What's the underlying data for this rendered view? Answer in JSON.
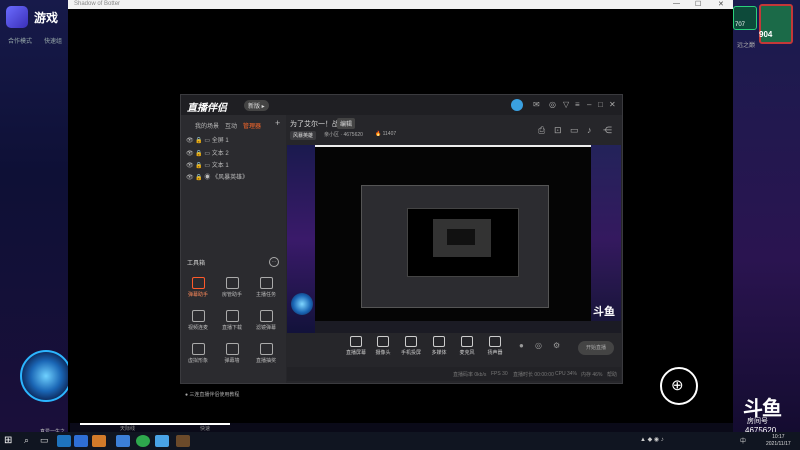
{
  "window": {
    "title": "Shadow of Botter",
    "controls": [
      "—",
      "☐",
      "✕"
    ]
  },
  "game": {
    "title": "游戏",
    "sub_labels": [
      "合作模式",
      "快速组"
    ],
    "hero_caption": "真爱一生之",
    "score": "904",
    "right_label": "远之巅",
    "right_badge": "707"
  },
  "douyu": {
    "brand": "斗鱼",
    "room_label": "房间号",
    "room_number": "4675620"
  },
  "app": {
    "brand": "直播伴侣",
    "version": "新版 ▸",
    "tabs": [
      "我的场景",
      "互动",
      "管理器"
    ],
    "add": "+",
    "sources": [
      "全屏 1",
      "文本 2",
      "文本 1",
      "《风暴英雄》"
    ],
    "toolbox_title": "工具箱",
    "more": "···",
    "tools": [
      {
        "label": "弹幕助手",
        "hot": true
      },
      {
        "label": "房管助手",
        "hot": false
      },
      {
        "label": "主播任务",
        "hot": false
      },
      {
        "label": "视频连麦",
        "hot": false
      },
      {
        "label": "直播下载",
        "hot": false
      },
      {
        "label": "滤镜弹幕",
        "hot": false
      },
      {
        "label": "虚拟形象",
        "hot": false
      },
      {
        "label": "弹幕墙",
        "hot": false
      },
      {
        "label": "直播抽奖",
        "hot": false
      }
    ],
    "footer": "三连直播伴侣使用教程",
    "room_title": "为了艾尔一！战",
    "room_tag": "编辑",
    "category": "风暴英雄",
    "fans": "亲小区 · 4675620",
    "heat": "🔥 11407",
    "controls": [
      "直播屏幕",
      "摄像头",
      "手机投屏",
      "多媒体",
      "麦克风",
      "扬声器"
    ],
    "start_button": "开始直播",
    "status": [
      "直播码率 0kb/s",
      "FPS 30",
      "直播时长 00:00:00",
      "CPU 34%",
      "内存 46%",
      "帮助"
    ]
  },
  "taskbar": {
    "time": "10:17",
    "date": "2021/11/17",
    "ime": "中",
    "bottom_labels": [
      "游戏",
      "天际线",
      "快速"
    ]
  },
  "colors": {
    "accent": "#ff6a2a",
    "app_bg": "#26262a",
    "taskbar": "#101521"
  }
}
